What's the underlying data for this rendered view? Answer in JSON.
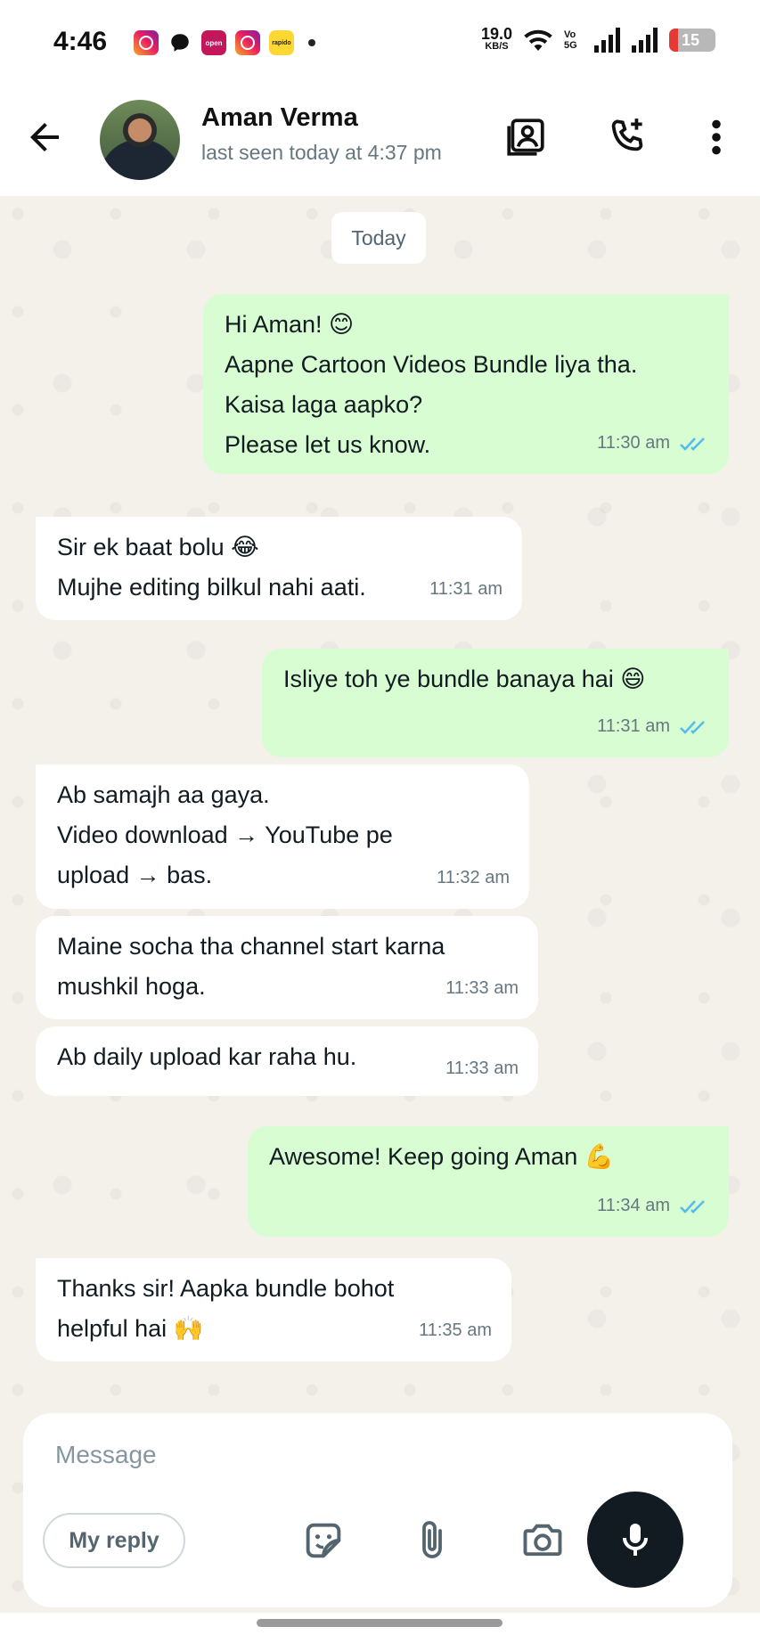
{
  "status_bar": {
    "time": "4:46",
    "apps": [
      "instagram-icon",
      "chat-bubble-icon",
      "open-app-icon",
      "instagram-icon",
      "rapido-icon"
    ],
    "open_label": "open",
    "rapido_label": "rapido",
    "net_speed": "19.0",
    "net_unit": "KB/S",
    "volte": "Vo 5G",
    "battery": "15"
  },
  "header": {
    "contact_name": "Aman Verma",
    "last_seen": "last seen today at 4:37 pm"
  },
  "chat": {
    "date_chip": "Today",
    "messages": [
      {
        "dir": "out",
        "lines": [
          "Hi Aman! 😊",
          "Aapne Cartoon Videos Bundle liya tha.",
          "Kaisa laga aapko?",
          "Please let us know."
        ],
        "time": "11:30 am",
        "read": true
      },
      {
        "dir": "in",
        "lines": [
          "Sir ek baat bolu 😂",
          "Mujhe editing bilkul nahi aati."
        ],
        "time": "11:31 am"
      },
      {
        "dir": "out",
        "lines": [
          "Isliye toh ye bundle banaya hai 😄"
        ],
        "time": "11:31 am",
        "read": true
      },
      {
        "dir": "in",
        "lines": [
          "Ab samajh aa gaya.",
          "Video download → YouTube pe",
          "upload → bas."
        ],
        "time": "11:32 am"
      },
      {
        "dir": "in",
        "lines": [
          "Maine socha tha channel start karna",
          "mushkil hoga."
        ],
        "time": "11:33 am"
      },
      {
        "dir": "in",
        "lines": [
          "Ab daily upload kar raha hu."
        ],
        "time": "11:33 am"
      },
      {
        "dir": "out",
        "lines": [
          "Awesome! Keep going Aman 💪"
        ],
        "time": "11:34 am",
        "read": true
      },
      {
        "dir": "in",
        "lines": [
          "Thanks sir! Aapka bundle bohot",
          "helpful hai 🙌"
        ],
        "time": "11:35 am"
      }
    ]
  },
  "composer": {
    "placeholder": "Message",
    "my_reply": "My reply"
  },
  "colors": {
    "outgoing_bubble": "#d9fdd3",
    "incoming_bubble": "#ffffff",
    "chat_bg": "#f4f0ea",
    "read_tick": "#53bdeb"
  }
}
